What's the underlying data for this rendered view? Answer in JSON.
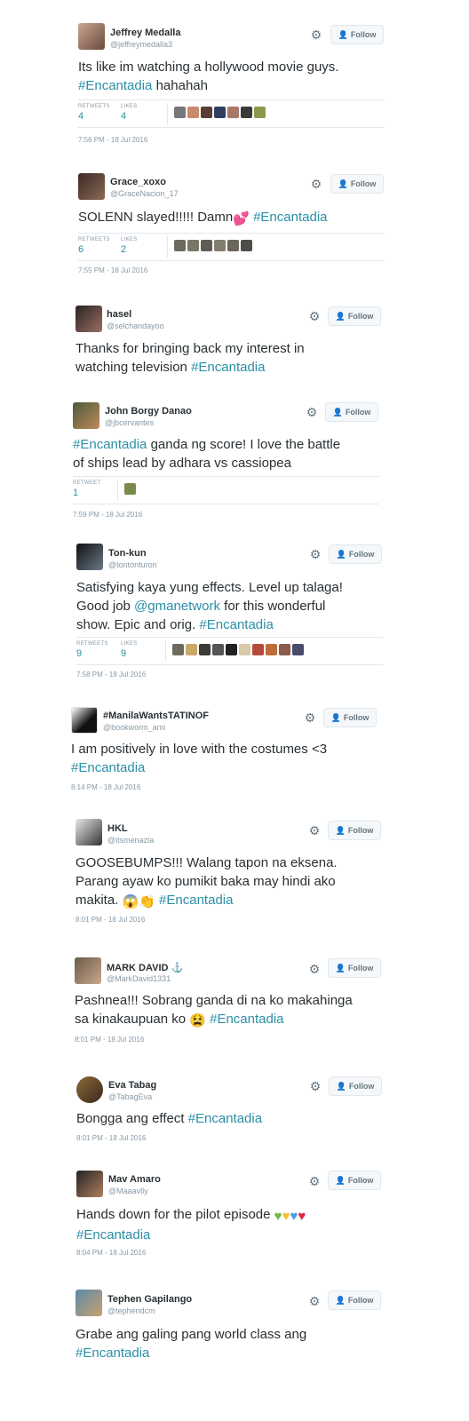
{
  "follow_label": "Follow",
  "tweets": [
    {
      "name": "Jeffrey Medalla",
      "handle": "@jeffreymedalla3",
      "line1": "Its like im watching a hollywood movie guys.",
      "line2_tag": "#Encantadia",
      "line2_rest": " hahahah",
      "retweets_label": "RETWEETS",
      "retweets": "4",
      "likes_label": "LIKES",
      "likes": "4",
      "time": "7:56 PM - 18 Jul 2016"
    },
    {
      "name": "Grace_xoxo",
      "handle": "@GraceNacion_17",
      "line1_text": "SOLENN slayed!!!!! Damn",
      "line1_tag": " #Encantadia",
      "retweets_label": "RETWEETS",
      "retweets": "6",
      "likes_label": "LIKES",
      "likes": "2",
      "time": "7:55 PM - 18 Jul 2016"
    },
    {
      "name": "hasel",
      "handle": "@selchandayoo",
      "line1": "Thanks for bringing back my interest in",
      "line2_text": "watching television ",
      "line2_tag": "#Encantadia"
    },
    {
      "name": "John Borgy Danao",
      "handle": "@jbcervantes",
      "line1_tag": "#Encantadia",
      "line1_text": " ganda ng score! I love the battle",
      "line2": "of ships lead by adhara vs cassiopea",
      "retweet_label": "RETWEET",
      "retweets": "1",
      "time": "7:59 PM - 18 Jul 2016"
    },
    {
      "name": "Ton-kun",
      "handle": "@tontonturon",
      "line1": "Satisfying kaya yung effects. Level up talaga!",
      "line2_text": "Good job ",
      "line2_mention": "@gmanetwork",
      "line2_rest": " for this wonderful",
      "line3_text": "show. Epic and orig. ",
      "line3_tag": "#Encantadia",
      "retweets_label": "RETWEETS",
      "retweets": "9",
      "likes_label": "LIKES",
      "likes": "9",
      "time": "7:58 PM - 18 Jul 2016"
    },
    {
      "name": "#ManilaWantsTATINOF",
      "handle": "@bookworm_ami",
      "line1": "I am positively in love with the costumes <3",
      "line2_tag": "#Encantadia",
      "time": "8:14 PM - 18 Jul 2016"
    },
    {
      "name": "HKL",
      "handle": "@itsmenazla",
      "line1": "GOOSEBUMPS!!! Walang tapon na eksena.",
      "line2": "Parang ayaw ko pumikit baka may hindi ako",
      "line3_text": "makita. ",
      "line3_tag": " #Encantadia",
      "time": "8:01 PM - 18 Jul 2016"
    },
    {
      "name": "MARK DAVID ⚓",
      "handle": "@MarkDavid1331",
      "line1": "Pashnea!!! Sobrang ganda di na ko makahinga",
      "line2_text": "sa kinakaupuan ko ",
      "line2_tag": " #Encantadia",
      "time": "8:01 PM - 18 Jul 2016"
    },
    {
      "name": "Eva Tabag",
      "handle": "@TabagEva",
      "line1_text": "Bongga ang effect ",
      "line1_tag": "#Encantadia",
      "time": "8:01 PM - 18 Jul 2016"
    },
    {
      "name": "Mav Amaro",
      "handle": "@Maaavlly",
      "line1": "Hands down for the pilot episode",
      "line2_tag": "#Encantadia",
      "time": "8:04 PM - 18 Jul 2016"
    },
    {
      "name": "Tephen Gapilango",
      "handle": "@tephendcm",
      "line1": "Grabe ang galing pang world class ang",
      "line2_tag": "#Encantadia"
    }
  ],
  "colors": {
    "hashtag": "#2a8fa6",
    "muted": "#8899a6",
    "text": "#292f33"
  },
  "icons": [
    "gear-icon",
    "follow-person-icon"
  ]
}
